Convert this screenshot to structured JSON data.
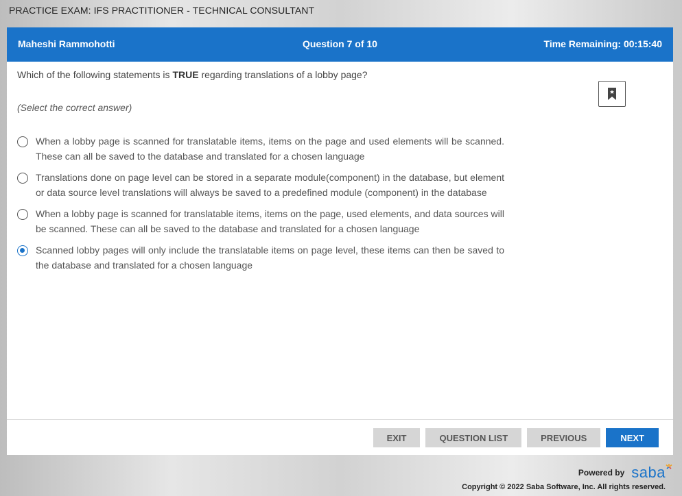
{
  "exam_title": "PRACTICE EXAM: IFS PRACTITIONER - TECHNICAL CONSULTANT",
  "header": {
    "user": "Maheshi Rammohotti",
    "question_counter": "Question 7 of 10",
    "time_remaining": "Time Remaining: 00:15:40"
  },
  "question": {
    "prefix": "Which of the following statements is ",
    "emphasis": "TRUE",
    "suffix": " regarding translations of a lobby page?",
    "instruction": "(Select the correct answer)",
    "options": [
      {
        "text": "When a lobby page is scanned for translatable items, items on the page and used elements will be scanned. These can all be saved to the database and translated for a chosen language",
        "selected": false
      },
      {
        "text": "Translations done on page level can be stored in a separate module(component) in the database, but element or data source level translations will always be saved to a predefined module (component) in the database",
        "selected": false
      },
      {
        "text": "When a lobby page is scanned for translatable items, items on the page, used elements, and data sources will be scanned. These can all be saved to the database and translated for a chosen language",
        "selected": false
      },
      {
        "text": "Scanned lobby pages will only include the translatable items on page level, these items can then be saved to the database and translated for a chosen language",
        "selected": true
      }
    ]
  },
  "buttons": {
    "exit": "EXIT",
    "question_list": "QUESTION LIST",
    "previous": "PREVIOUS",
    "next": "NEXT"
  },
  "footer": {
    "powered_by": "Powered by",
    "brand": "saba",
    "copyright": "Copyright © 2022 Saba Software, Inc. All rights reserved."
  },
  "icons": {
    "bookmark": "bookmark-icon",
    "radio": "radio-button"
  },
  "colors": {
    "accent": "#1a73c9",
    "button_gray": "#d6d6d6"
  }
}
